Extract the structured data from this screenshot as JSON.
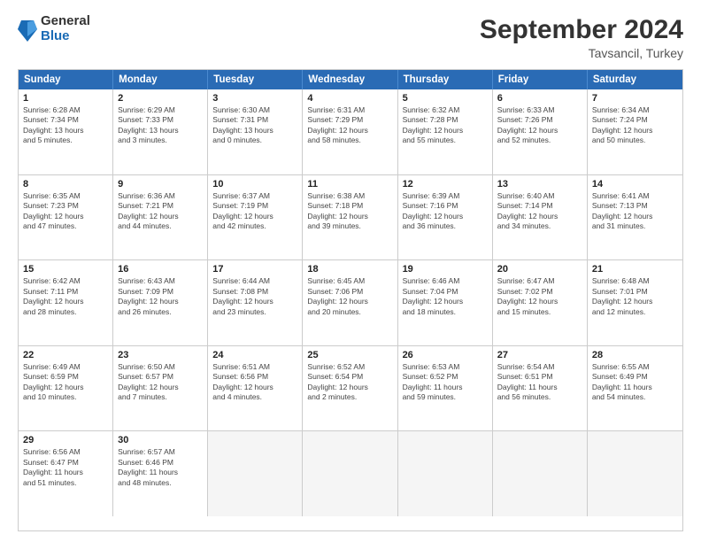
{
  "header": {
    "logo_general": "General",
    "logo_blue": "Blue",
    "month_title": "September 2024",
    "location": "Tavsancil, Turkey"
  },
  "weekdays": [
    "Sunday",
    "Monday",
    "Tuesday",
    "Wednesday",
    "Thursday",
    "Friday",
    "Saturday"
  ],
  "rows": [
    [
      {
        "day": "",
        "lines": [],
        "empty": true
      },
      {
        "day": "",
        "lines": [],
        "empty": true
      },
      {
        "day": "",
        "lines": [],
        "empty": true
      },
      {
        "day": "",
        "lines": [],
        "empty": true
      },
      {
        "day": "",
        "lines": [],
        "empty": true
      },
      {
        "day": "",
        "lines": [],
        "empty": true
      },
      {
        "day": "",
        "lines": [],
        "empty": true
      }
    ],
    [
      {
        "day": "1",
        "lines": [
          "Sunrise: 6:28 AM",
          "Sunset: 7:34 PM",
          "Daylight: 13 hours",
          "and 5 minutes."
        ],
        "empty": false
      },
      {
        "day": "2",
        "lines": [
          "Sunrise: 6:29 AM",
          "Sunset: 7:33 PM",
          "Daylight: 13 hours",
          "and 3 minutes."
        ],
        "empty": false
      },
      {
        "day": "3",
        "lines": [
          "Sunrise: 6:30 AM",
          "Sunset: 7:31 PM",
          "Daylight: 13 hours",
          "and 0 minutes."
        ],
        "empty": false
      },
      {
        "day": "4",
        "lines": [
          "Sunrise: 6:31 AM",
          "Sunset: 7:29 PM",
          "Daylight: 12 hours",
          "and 58 minutes."
        ],
        "empty": false
      },
      {
        "day": "5",
        "lines": [
          "Sunrise: 6:32 AM",
          "Sunset: 7:28 PM",
          "Daylight: 12 hours",
          "and 55 minutes."
        ],
        "empty": false
      },
      {
        "day": "6",
        "lines": [
          "Sunrise: 6:33 AM",
          "Sunset: 7:26 PM",
          "Daylight: 12 hours",
          "and 52 minutes."
        ],
        "empty": false
      },
      {
        "day": "7",
        "lines": [
          "Sunrise: 6:34 AM",
          "Sunset: 7:24 PM",
          "Daylight: 12 hours",
          "and 50 minutes."
        ],
        "empty": false
      }
    ],
    [
      {
        "day": "8",
        "lines": [
          "Sunrise: 6:35 AM",
          "Sunset: 7:23 PM",
          "Daylight: 12 hours",
          "and 47 minutes."
        ],
        "empty": false
      },
      {
        "day": "9",
        "lines": [
          "Sunrise: 6:36 AM",
          "Sunset: 7:21 PM",
          "Daylight: 12 hours",
          "and 44 minutes."
        ],
        "empty": false
      },
      {
        "day": "10",
        "lines": [
          "Sunrise: 6:37 AM",
          "Sunset: 7:19 PM",
          "Daylight: 12 hours",
          "and 42 minutes."
        ],
        "empty": false
      },
      {
        "day": "11",
        "lines": [
          "Sunrise: 6:38 AM",
          "Sunset: 7:18 PM",
          "Daylight: 12 hours",
          "and 39 minutes."
        ],
        "empty": false
      },
      {
        "day": "12",
        "lines": [
          "Sunrise: 6:39 AM",
          "Sunset: 7:16 PM",
          "Daylight: 12 hours",
          "and 36 minutes."
        ],
        "empty": false
      },
      {
        "day": "13",
        "lines": [
          "Sunrise: 6:40 AM",
          "Sunset: 7:14 PM",
          "Daylight: 12 hours",
          "and 34 minutes."
        ],
        "empty": false
      },
      {
        "day": "14",
        "lines": [
          "Sunrise: 6:41 AM",
          "Sunset: 7:13 PM",
          "Daylight: 12 hours",
          "and 31 minutes."
        ],
        "empty": false
      }
    ],
    [
      {
        "day": "15",
        "lines": [
          "Sunrise: 6:42 AM",
          "Sunset: 7:11 PM",
          "Daylight: 12 hours",
          "and 28 minutes."
        ],
        "empty": false
      },
      {
        "day": "16",
        "lines": [
          "Sunrise: 6:43 AM",
          "Sunset: 7:09 PM",
          "Daylight: 12 hours",
          "and 26 minutes."
        ],
        "empty": false
      },
      {
        "day": "17",
        "lines": [
          "Sunrise: 6:44 AM",
          "Sunset: 7:08 PM",
          "Daylight: 12 hours",
          "and 23 minutes."
        ],
        "empty": false
      },
      {
        "day": "18",
        "lines": [
          "Sunrise: 6:45 AM",
          "Sunset: 7:06 PM",
          "Daylight: 12 hours",
          "and 20 minutes."
        ],
        "empty": false
      },
      {
        "day": "19",
        "lines": [
          "Sunrise: 6:46 AM",
          "Sunset: 7:04 PM",
          "Daylight: 12 hours",
          "and 18 minutes."
        ],
        "empty": false
      },
      {
        "day": "20",
        "lines": [
          "Sunrise: 6:47 AM",
          "Sunset: 7:02 PM",
          "Daylight: 12 hours",
          "and 15 minutes."
        ],
        "empty": false
      },
      {
        "day": "21",
        "lines": [
          "Sunrise: 6:48 AM",
          "Sunset: 7:01 PM",
          "Daylight: 12 hours",
          "and 12 minutes."
        ],
        "empty": false
      }
    ],
    [
      {
        "day": "22",
        "lines": [
          "Sunrise: 6:49 AM",
          "Sunset: 6:59 PM",
          "Daylight: 12 hours",
          "and 10 minutes."
        ],
        "empty": false
      },
      {
        "day": "23",
        "lines": [
          "Sunrise: 6:50 AM",
          "Sunset: 6:57 PM",
          "Daylight: 12 hours",
          "and 7 minutes."
        ],
        "empty": false
      },
      {
        "day": "24",
        "lines": [
          "Sunrise: 6:51 AM",
          "Sunset: 6:56 PM",
          "Daylight: 12 hours",
          "and 4 minutes."
        ],
        "empty": false
      },
      {
        "day": "25",
        "lines": [
          "Sunrise: 6:52 AM",
          "Sunset: 6:54 PM",
          "Daylight: 12 hours",
          "and 2 minutes."
        ],
        "empty": false
      },
      {
        "day": "26",
        "lines": [
          "Sunrise: 6:53 AM",
          "Sunset: 6:52 PM",
          "Daylight: 11 hours",
          "and 59 minutes."
        ],
        "empty": false
      },
      {
        "day": "27",
        "lines": [
          "Sunrise: 6:54 AM",
          "Sunset: 6:51 PM",
          "Daylight: 11 hours",
          "and 56 minutes."
        ],
        "empty": false
      },
      {
        "day": "28",
        "lines": [
          "Sunrise: 6:55 AM",
          "Sunset: 6:49 PM",
          "Daylight: 11 hours",
          "and 54 minutes."
        ],
        "empty": false
      }
    ],
    [
      {
        "day": "29",
        "lines": [
          "Sunrise: 6:56 AM",
          "Sunset: 6:47 PM",
          "Daylight: 11 hours",
          "and 51 minutes."
        ],
        "empty": false
      },
      {
        "day": "30",
        "lines": [
          "Sunrise: 6:57 AM",
          "Sunset: 6:46 PM",
          "Daylight: 11 hours",
          "and 48 minutes."
        ],
        "empty": false
      },
      {
        "day": "",
        "lines": [],
        "empty": true
      },
      {
        "day": "",
        "lines": [],
        "empty": true
      },
      {
        "day": "",
        "lines": [],
        "empty": true
      },
      {
        "day": "",
        "lines": [],
        "empty": true
      },
      {
        "day": "",
        "lines": [],
        "empty": true
      }
    ]
  ]
}
